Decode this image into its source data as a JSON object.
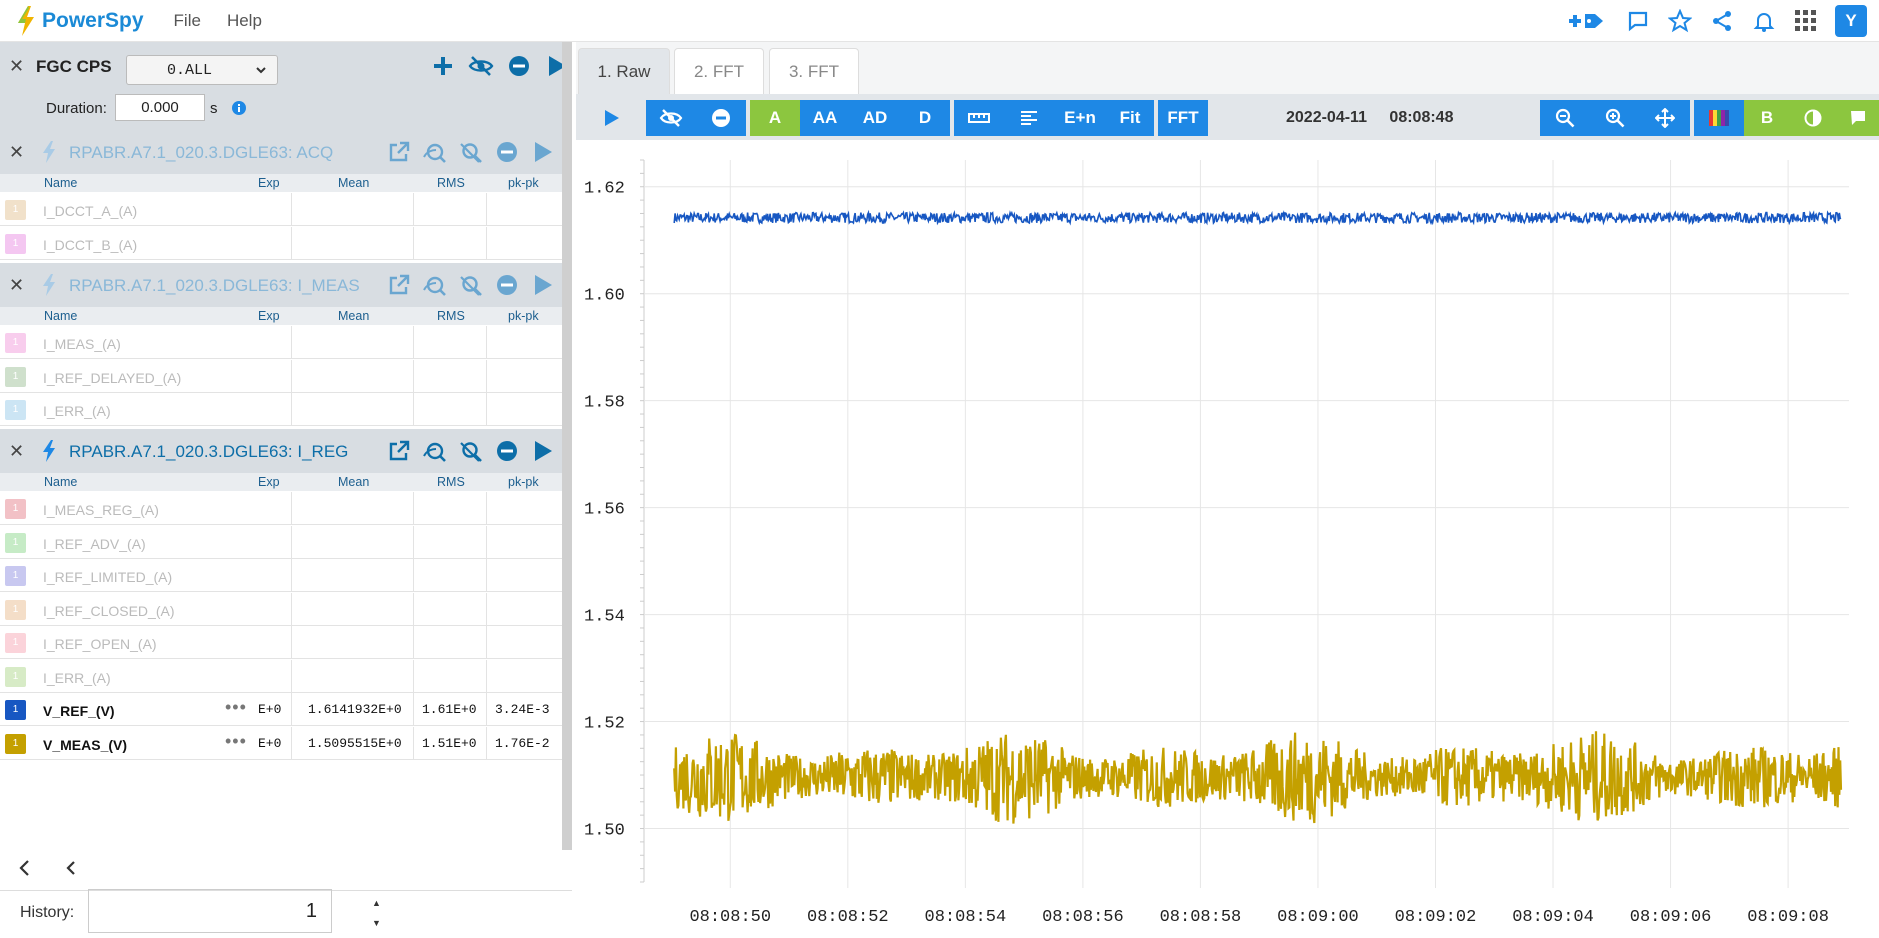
{
  "app": {
    "name": "PowerSpy",
    "menu": [
      "File",
      "Help"
    ]
  },
  "fgc": {
    "title": "FGC CPS",
    "select_value": "0.ALL",
    "duration_label": "Duration:",
    "duration_value": "0.000",
    "duration_unit": "s"
  },
  "columns": {
    "name": "Name",
    "exp": "Exp",
    "mean": "Mean",
    "rms": "RMS",
    "pkpk": "pk-pk"
  },
  "groups": [
    {
      "title": "RPABR.A7.1_020.3.DGLE63: ACQ",
      "active": false,
      "signals": [
        {
          "name": "I_DCCT_A_(A)",
          "color": "#e6c9a0",
          "active": false
        },
        {
          "name": "I_DCCT_B_(A)",
          "color": "#ec9ae6",
          "active": false
        }
      ]
    },
    {
      "title": "RPABR.A7.1_020.3.DGLE63: I_MEAS",
      "active": false,
      "signals": [
        {
          "name": "I_MEAS_(A)",
          "color": "#f4a6e0",
          "active": false
        },
        {
          "name": "I_REF_DELAYED_(A)",
          "color": "#a8c8a4",
          "active": false
        },
        {
          "name": "I_ERR_(A)",
          "color": "#a4d0ec",
          "active": false
        }
      ]
    },
    {
      "title": "RPABR.A7.1_020.3.DGLE63: I_REG",
      "active": true,
      "signals": [
        {
          "name": "I_MEAS_REG_(A)",
          "color": "#e89098",
          "active": false
        },
        {
          "name": "I_REF_ADV_(A)",
          "color": "#98dc98",
          "active": false
        },
        {
          "name": "I_REF_LIMITED_(A)",
          "color": "#9c9ce4",
          "active": false
        },
        {
          "name": "I_REF_CLOSED_(A)",
          "color": "#ecc49c",
          "active": false
        },
        {
          "name": "I_REF_OPEN_(A)",
          "color": "#f8b0bc",
          "active": false
        },
        {
          "name": "I_ERR_(A)",
          "color": "#b8dc98",
          "active": false
        },
        {
          "name": "V_REF_(V)",
          "color": "#1757c2",
          "active": true,
          "exp": "E+0",
          "mean": "1.6141932E+0",
          "rms": "1.61E+0",
          "pkpk": "3.24E-3"
        },
        {
          "name": "V_MEAS_(V)",
          "color": "#c4a000",
          "active": true,
          "exp": "E+0",
          "mean": "1.5095515E+0",
          "rms": "1.51E+0",
          "pkpk": "1.76E-2"
        }
      ]
    }
  ],
  "history": {
    "label": "History:",
    "value": "1"
  },
  "tabs": [
    {
      "label": "1. Raw",
      "active": true
    },
    {
      "label": "2. FFT",
      "active": false
    },
    {
      "label": "3. FFT",
      "active": false
    }
  ],
  "toolbar": {
    "a": "A",
    "aa": "AA",
    "ad": "AD",
    "d": "D",
    "en": "E+n",
    "fit": "Fit",
    "fft": "FFT",
    "b": "B"
  },
  "timestamp": {
    "date": "2022-04-11",
    "time": "08:08:48"
  },
  "user": {
    "initial": "Y"
  },
  "chart_data": {
    "type": "line",
    "title": "",
    "xlabel": "",
    "ylabel": "",
    "ylim": [
      1.49,
      1.625
    ],
    "xlim": [
      "08:08:48.6",
      "08:09:08.9"
    ],
    "yticks": [
      "1.50",
      "1.52",
      "1.54",
      "1.56",
      "1.58",
      "1.60",
      "1.62"
    ],
    "xticks": [
      "08:08:50",
      "08:08:52",
      "08:08:54",
      "08:08:56",
      "08:08:58",
      "08:09:00",
      "08:09:02",
      "08:09:04",
      "08:09:06",
      "08:09:08"
    ],
    "grid": true,
    "series": [
      {
        "name": "V_REF_(V)",
        "color": "#1757c2",
        "mean": 1.6142,
        "pkpk": 0.00324
      },
      {
        "name": "V_MEAS_(V)",
        "color": "#c4a000",
        "mean": 1.5096,
        "pkpk": 0.0176
      }
    ]
  }
}
